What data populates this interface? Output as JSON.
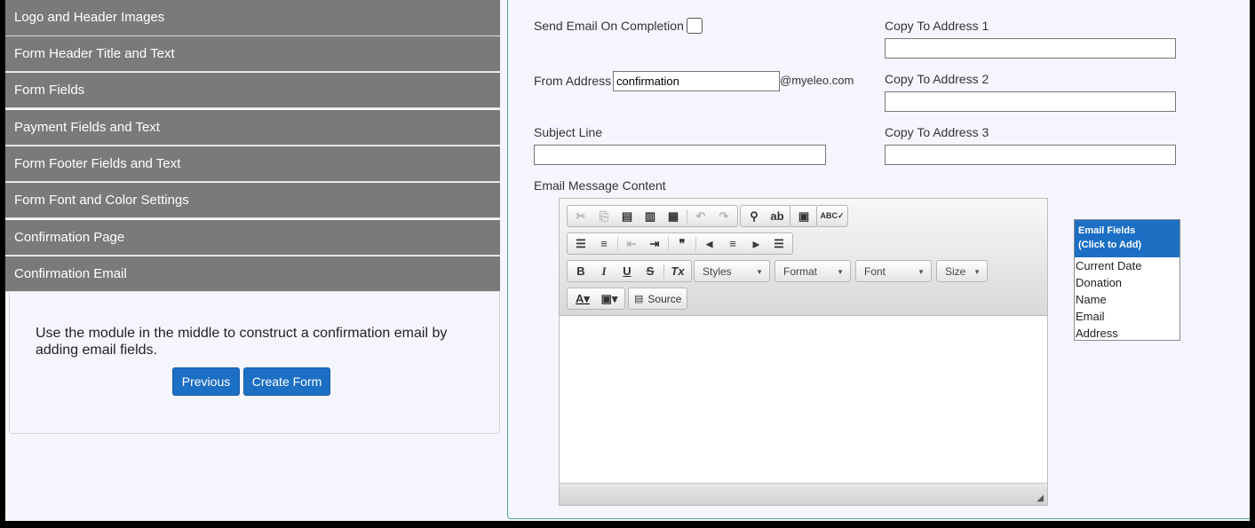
{
  "accordion": {
    "items": [
      {
        "label": "Logo and Header Images"
      },
      {
        "label": "Form Header Title and Text"
      },
      {
        "label": "Form Fields"
      },
      {
        "label": "Payment Fields and Text"
      },
      {
        "label": "Form Footer Fields and Text"
      },
      {
        "label": "Form Font and Color Settings"
      },
      {
        "label": "Confirmation Page"
      },
      {
        "label": "Confirmation Email"
      }
    ]
  },
  "info": {
    "text": "Use the module in the middle to construct a confirmation email by adding email fields.",
    "previous_label": "Previous",
    "create_label": "Create Form"
  },
  "form": {
    "send_email_label": "Send Email On Completion",
    "send_email_checked": false,
    "from_label": "From Address",
    "from_value": "confirmation",
    "from_domain": "@myeleo.com",
    "subject_label": "Subject Line",
    "subject_value": "",
    "content_label": "Email Message Content",
    "copy1_label": "Copy To Address 1",
    "copy1_value": "",
    "copy2_label": "Copy To Address 2",
    "copy2_value": "",
    "copy3_label": "Copy To Address 3",
    "copy3_value": ""
  },
  "editor": {
    "styles_label": "Styles",
    "format_label": "Format",
    "font_label": "Font",
    "size_label": "Size",
    "source_label": "Source"
  },
  "email_fields": {
    "title": "Email Fields",
    "subtitle": "(Click to Add)",
    "items": [
      "Current Date",
      "Donation",
      "Name",
      "Email",
      "Address"
    ]
  },
  "colors": {
    "accent": "#1d6fc4",
    "accordion_bg": "#7a7a7a",
    "panel_border": "#4aa3a3",
    "page_bg": "#f5f6fd"
  }
}
